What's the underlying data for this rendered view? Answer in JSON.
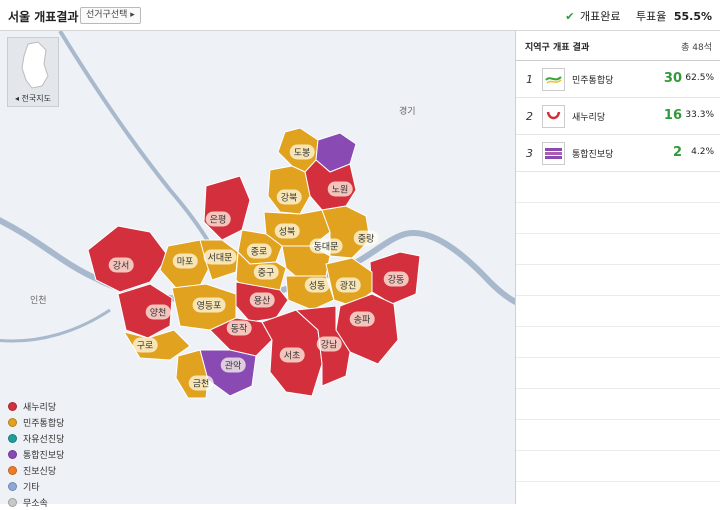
{
  "header": {
    "title": "서울 개표결과",
    "select_label": "선거구선택 ▸",
    "check": "✔",
    "done_label": "개표완료",
    "rate_label": "투표율",
    "rate_value": "55.5%"
  },
  "map": {
    "korea_label": "◂ 전국지도",
    "places": [
      "경기",
      "인천"
    ],
    "colors": {
      "saenuri": "#d32f3c",
      "minju": "#e0a21f",
      "jinbo": "#8a4ab4",
      "river": "#a9b9cd"
    },
    "districts": [
      {
        "name": "도봉",
        "party": "minju"
      },
      {
        "name": "노원",
        "party": "saenuri"
      },
      {
        "name": "강북",
        "party": "minju"
      },
      {
        "name": "은평",
        "party": "saenuri"
      },
      {
        "name": "성북",
        "party": "minju"
      },
      {
        "name": "중랑",
        "party": "minju"
      },
      {
        "name": "종로",
        "party": "minju"
      },
      {
        "name": "동대문",
        "party": "minju"
      },
      {
        "name": "강서",
        "party": "saenuri"
      },
      {
        "name": "마포",
        "party": "minju"
      },
      {
        "name": "서대문",
        "party": "minju"
      },
      {
        "name": "중구",
        "party": "minju"
      },
      {
        "name": "강동",
        "party": "saenuri"
      },
      {
        "name": "성동",
        "party": "minju"
      },
      {
        "name": "광진",
        "party": "minju"
      },
      {
        "name": "용산",
        "party": "saenuri"
      },
      {
        "name": "양천",
        "party": "saenuri"
      },
      {
        "name": "영등포",
        "party": "minju"
      },
      {
        "name": "송파",
        "party": "saenuri"
      },
      {
        "name": "동작",
        "party": "saenuri"
      },
      {
        "name": "구로",
        "party": "minju"
      },
      {
        "name": "서초",
        "party": "saenuri"
      },
      {
        "name": "강남",
        "party": "saenuri"
      },
      {
        "name": "관악",
        "party": "jinbo"
      },
      {
        "name": "금천",
        "party": "minju"
      }
    ]
  },
  "legend": [
    {
      "label": "새누리당",
      "color": "#d32f3c"
    },
    {
      "label": "민주통합당",
      "color": "#e0a21f"
    },
    {
      "label": "자유선진당",
      "color": "#1f9e9b"
    },
    {
      "label": "통합진보당",
      "color": "#8a4ab4"
    },
    {
      "label": "진보신당",
      "color": "#ef7b2a"
    },
    {
      "label": "기타",
      "color": "#8ea9d9"
    },
    {
      "label": "무소속",
      "color": "#c9c9c9"
    }
  ],
  "results": {
    "title": "지역구 개표 결과",
    "total": "총 48석",
    "rows": [
      {
        "rank": "1",
        "party": "민주통합당",
        "seats": "30",
        "pct": "62.5%",
        "logo": "minju-logo-icon"
      },
      {
        "rank": "2",
        "party": "새누리당",
        "seats": "16",
        "pct": "33.3%",
        "logo": "saenuri-logo-icon"
      },
      {
        "rank": "3",
        "party": "통합진보당",
        "seats": "2",
        "pct": "4.2%",
        "logo": "jinbo-logo-icon"
      }
    ]
  }
}
